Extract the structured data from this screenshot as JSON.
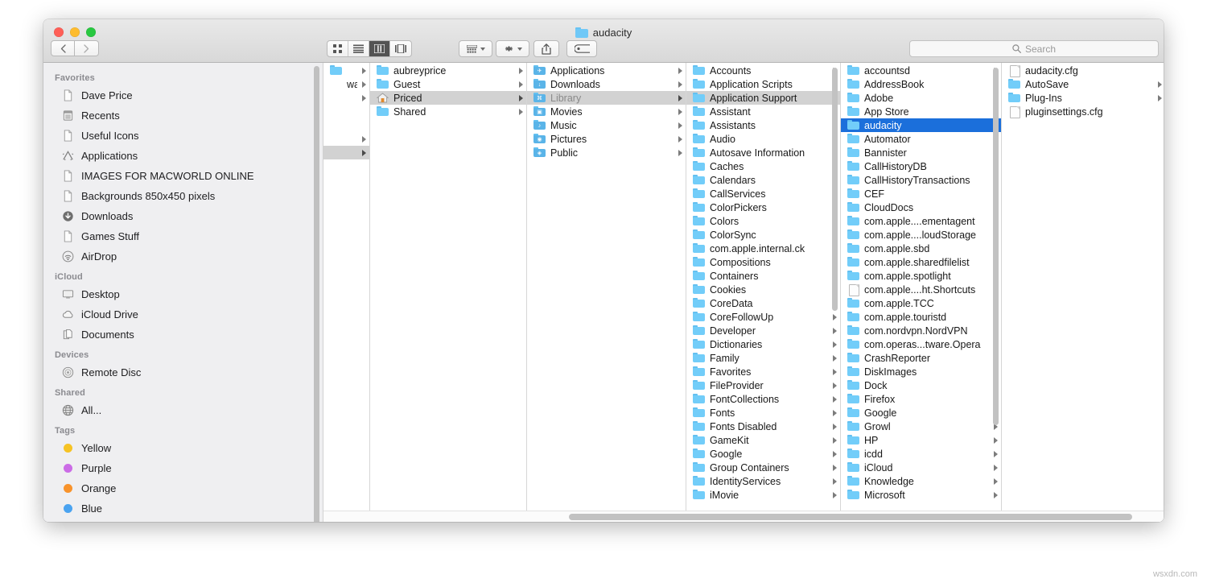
{
  "window": {
    "title": "audacity",
    "title_icon": "folder-icon",
    "traffic_lights": [
      {
        "name": "close",
        "color": "#ff5f57"
      },
      {
        "name": "minimize",
        "color": "#febc2e"
      },
      {
        "name": "zoom",
        "color": "#28c840"
      }
    ]
  },
  "toolbar": {
    "back_label": "‹",
    "forward_label": "›",
    "view_modes": [
      {
        "name": "icon-view",
        "icon": "grid-icon",
        "active": false
      },
      {
        "name": "list-view",
        "icon": "list-icon",
        "active": false
      },
      {
        "name": "column-view",
        "icon": "columns-icon",
        "active": true
      },
      {
        "name": "gallery-view",
        "icon": "gallery-icon",
        "active": false
      }
    ],
    "group_button": {
      "name": "group-by",
      "icon": "group-icon"
    },
    "action_button": {
      "name": "action-menu",
      "icon": "gear-icon"
    },
    "share_button": {
      "name": "share",
      "icon": "share-icon"
    },
    "tags_button": {
      "name": "tags",
      "icon": "tag-icon"
    }
  },
  "search": {
    "placeholder": "Search",
    "icon": "search-icon",
    "value": ""
  },
  "sidebar": {
    "sections": [
      {
        "title": "Favorites",
        "items": [
          {
            "label": "Dave Price",
            "icon": "document-icon"
          },
          {
            "label": "Recents",
            "icon": "recents-icon"
          },
          {
            "label": "Useful Icons",
            "icon": "document-icon"
          },
          {
            "label": "Applications",
            "icon": "applications-icon"
          },
          {
            "label": "IMAGES FOR MACWORLD ONLINE",
            "icon": "document-icon"
          },
          {
            "label": "Backgrounds 850x450 pixels",
            "icon": "document-icon"
          },
          {
            "label": "Downloads",
            "icon": "downloads-icon"
          },
          {
            "label": "Games Stuff",
            "icon": "document-icon"
          },
          {
            "label": "AirDrop",
            "icon": "airdrop-icon"
          }
        ]
      },
      {
        "title": "iCloud",
        "items": [
          {
            "label": "Desktop",
            "icon": "desktop-icon"
          },
          {
            "label": "iCloud Drive",
            "icon": "cloud-icon"
          },
          {
            "label": "Documents",
            "icon": "documents-icon"
          }
        ]
      },
      {
        "title": "Devices",
        "items": [
          {
            "label": "Remote Disc",
            "icon": "disc-icon"
          }
        ]
      },
      {
        "title": "Shared",
        "items": [
          {
            "label": "All...",
            "icon": "globe-icon"
          }
        ]
      },
      {
        "title": "Tags",
        "items": [
          {
            "label": "Yellow",
            "icon": "tag-dot-icon",
            "color": "#f8c察"
          },
          {
            "label": "Purple",
            "icon": "tag-dot-icon",
            "color": "#cb6ce6"
          },
          {
            "label": "Orange",
            "icon": "tag-dot-icon",
            "color": "#f8932b"
          },
          {
            "label": "Blue",
            "icon": "tag-dot-icon",
            "color": "#4aa3f0"
          }
        ]
      }
    ],
    "tag_colors": {
      "Yellow": "#f6c324",
      "Purple": "#cb6ce6",
      "Orange": "#f8932b",
      "Blue": "#4aa3f0"
    }
  },
  "columns": [
    {
      "name": "column-partial",
      "truncated": true,
      "items": [
        {
          "label": "",
          "icon": "folder-icon",
          "has_arrow": true,
          "selected": false
        },
        {
          "label": "ware",
          "icon": "none",
          "has_arrow": true,
          "selected": false
        },
        {
          "label": "",
          "icon": "none",
          "has_arrow": true,
          "selected": false
        },
        {
          "label": "",
          "icon": "none",
          "has_arrow": false,
          "selected": false
        },
        {
          "label": "",
          "icon": "none",
          "has_arrow": false,
          "selected": false
        },
        {
          "label": "",
          "icon": "none",
          "has_arrow": true,
          "selected": false
        },
        {
          "label": "",
          "icon": "none",
          "has_arrow": true,
          "selected": true
        }
      ]
    },
    {
      "name": "column-users",
      "items": [
        {
          "label": "aubreyprice",
          "icon": "folder-icon",
          "has_arrow": true,
          "selected": false
        },
        {
          "label": "Guest",
          "icon": "folder-icon",
          "has_arrow": true,
          "selected": false
        },
        {
          "label": "Priced",
          "icon": "home-icon",
          "has_arrow": true,
          "selected": true
        },
        {
          "label": "Shared",
          "icon": "folder-icon",
          "has_arrow": true,
          "selected": false
        }
      ]
    },
    {
      "name": "column-home",
      "items": [
        {
          "label": "Applications",
          "icon": "folder-applications-icon",
          "has_arrow": true,
          "selected": false
        },
        {
          "label": "Downloads",
          "icon": "folder-downloads-icon",
          "has_arrow": true,
          "selected": false
        },
        {
          "label": "Library",
          "icon": "folder-library-icon",
          "has_arrow": true,
          "selected": true,
          "dimmed": true
        },
        {
          "label": "Movies",
          "icon": "folder-movies-icon",
          "has_arrow": true,
          "selected": false
        },
        {
          "label": "Music",
          "icon": "folder-music-icon",
          "has_arrow": true,
          "selected": false
        },
        {
          "label": "Pictures",
          "icon": "folder-pictures-icon",
          "has_arrow": true,
          "selected": false
        },
        {
          "label": "Public",
          "icon": "folder-public-icon",
          "has_arrow": true,
          "selected": false
        }
      ]
    },
    {
      "name": "column-library",
      "scrollbar": {
        "top_pct": 0,
        "height_pct": 53
      },
      "items": [
        {
          "label": "Accounts",
          "icon": "folder-icon",
          "has_arrow": true,
          "selected": false
        },
        {
          "label": "Application Scripts",
          "icon": "folder-icon",
          "has_arrow": true,
          "selected": false
        },
        {
          "label": "Application Support",
          "icon": "folder-icon",
          "has_arrow": true,
          "selected": true
        },
        {
          "label": "Assistant",
          "icon": "folder-icon",
          "has_arrow": true,
          "selected": false
        },
        {
          "label": "Assistants",
          "icon": "folder-icon",
          "has_arrow": true,
          "selected": false
        },
        {
          "label": "Audio",
          "icon": "folder-icon",
          "has_arrow": true,
          "selected": false
        },
        {
          "label": "Autosave Information",
          "icon": "folder-icon",
          "has_arrow": true,
          "selected": false
        },
        {
          "label": "Caches",
          "icon": "folder-icon",
          "has_arrow": true,
          "selected": false
        },
        {
          "label": "Calendars",
          "icon": "folder-icon",
          "has_arrow": true,
          "selected": false
        },
        {
          "label": "CallServices",
          "icon": "folder-icon",
          "has_arrow": true,
          "selected": false
        },
        {
          "label": "ColorPickers",
          "icon": "folder-icon",
          "has_arrow": true,
          "selected": false
        },
        {
          "label": "Colors",
          "icon": "folder-icon",
          "has_arrow": true,
          "selected": false
        },
        {
          "label": "ColorSync",
          "icon": "folder-icon",
          "has_arrow": true,
          "selected": false
        },
        {
          "label": "com.apple.internal.ck",
          "icon": "folder-icon",
          "has_arrow": true,
          "selected": false
        },
        {
          "label": "Compositions",
          "icon": "folder-icon",
          "has_arrow": true,
          "selected": false
        },
        {
          "label": "Containers",
          "icon": "folder-icon",
          "has_arrow": true,
          "selected": false
        },
        {
          "label": "Cookies",
          "icon": "folder-icon",
          "has_arrow": true,
          "selected": false
        },
        {
          "label": "CoreData",
          "icon": "folder-icon",
          "has_arrow": true,
          "selected": false
        },
        {
          "label": "CoreFollowUp",
          "icon": "folder-icon",
          "has_arrow": true,
          "selected": false
        },
        {
          "label": "Developer",
          "icon": "folder-icon",
          "has_arrow": true,
          "selected": false
        },
        {
          "label": "Dictionaries",
          "icon": "folder-icon",
          "has_arrow": true,
          "selected": false
        },
        {
          "label": "Family",
          "icon": "folder-icon",
          "has_arrow": true,
          "selected": false
        },
        {
          "label": "Favorites",
          "icon": "folder-icon",
          "has_arrow": true,
          "selected": false
        },
        {
          "label": "FileProvider",
          "icon": "folder-icon",
          "has_arrow": true,
          "selected": false
        },
        {
          "label": "FontCollections",
          "icon": "folder-icon",
          "has_arrow": true,
          "selected": false
        },
        {
          "label": "Fonts",
          "icon": "folder-icon",
          "has_arrow": true,
          "selected": false
        },
        {
          "label": "Fonts Disabled",
          "icon": "folder-icon",
          "has_arrow": true,
          "selected": false
        },
        {
          "label": "GameKit",
          "icon": "folder-icon",
          "has_arrow": true,
          "selected": false
        },
        {
          "label": "Google",
          "icon": "folder-icon",
          "has_arrow": true,
          "selected": false
        },
        {
          "label": "Group Containers",
          "icon": "folder-icon",
          "has_arrow": true,
          "selected": false
        },
        {
          "label": "IdentityServices",
          "icon": "folder-icon",
          "has_arrow": true,
          "selected": false
        },
        {
          "label": "iMovie",
          "icon": "folder-icon",
          "has_arrow": true,
          "selected": false
        }
      ]
    },
    {
      "name": "column-application-support",
      "scrollbar": {
        "top_pct": 0,
        "height_pct": 78
      },
      "items": [
        {
          "label": "accountsd",
          "icon": "folder-icon",
          "has_arrow": true,
          "selected": false
        },
        {
          "label": "AddressBook",
          "icon": "folder-icon",
          "has_arrow": true,
          "selected": false
        },
        {
          "label": "Adobe",
          "icon": "folder-icon",
          "has_arrow": true,
          "selected": false
        },
        {
          "label": "App Store",
          "icon": "folder-icon",
          "has_arrow": true,
          "selected": false
        },
        {
          "label": "audacity",
          "icon": "folder-icon",
          "has_arrow": true,
          "selected": true
        },
        {
          "label": "Automator",
          "icon": "folder-icon",
          "has_arrow": true,
          "selected": false
        },
        {
          "label": "Bannister",
          "icon": "folder-icon",
          "has_arrow": true,
          "selected": false
        },
        {
          "label": "CallHistoryDB",
          "icon": "folder-icon",
          "has_arrow": true,
          "selected": false
        },
        {
          "label": "CallHistoryTransactions",
          "icon": "folder-icon",
          "has_arrow": true,
          "selected": false
        },
        {
          "label": "CEF",
          "icon": "folder-icon",
          "has_arrow": true,
          "selected": false
        },
        {
          "label": "CloudDocs",
          "icon": "folder-icon",
          "has_arrow": true,
          "selected": false
        },
        {
          "label": "com.apple....ementagent",
          "icon": "folder-icon",
          "has_arrow": true,
          "selected": false
        },
        {
          "label": "com.apple....loudStorage",
          "icon": "folder-icon",
          "has_arrow": true,
          "selected": false
        },
        {
          "label": "com.apple.sbd",
          "icon": "folder-icon",
          "has_arrow": true,
          "selected": false
        },
        {
          "label": "com.apple.sharedfilelist",
          "icon": "folder-icon",
          "has_arrow": true,
          "selected": false
        },
        {
          "label": "com.apple.spotlight",
          "icon": "folder-icon",
          "has_arrow": true,
          "selected": false
        },
        {
          "label": "com.apple....ht.Shortcuts",
          "icon": "file-icon",
          "has_arrow": false,
          "selected": false
        },
        {
          "label": "com.apple.TCC",
          "icon": "folder-icon",
          "has_arrow": true,
          "selected": false
        },
        {
          "label": "com.apple.touristd",
          "icon": "folder-icon",
          "has_arrow": true,
          "selected": false
        },
        {
          "label": "com.nordvpn.NordVPN",
          "icon": "folder-icon",
          "has_arrow": true,
          "selected": false
        },
        {
          "label": "com.operas...tware.Opera",
          "icon": "folder-icon",
          "has_arrow": true,
          "selected": false
        },
        {
          "label": "CrashReporter",
          "icon": "folder-icon",
          "has_arrow": true,
          "selected": false
        },
        {
          "label": "DiskImages",
          "icon": "folder-icon",
          "has_arrow": true,
          "selected": false
        },
        {
          "label": "Dock",
          "icon": "folder-icon",
          "has_arrow": true,
          "selected": false
        },
        {
          "label": "Firefox",
          "icon": "folder-icon",
          "has_arrow": true,
          "selected": false
        },
        {
          "label": "Google",
          "icon": "folder-icon",
          "has_arrow": true,
          "selected": false
        },
        {
          "label": "Growl",
          "icon": "folder-icon",
          "has_arrow": true,
          "selected": false
        },
        {
          "label": "HP",
          "icon": "folder-icon",
          "has_arrow": true,
          "selected": false
        },
        {
          "label": "icdd",
          "icon": "folder-icon",
          "has_arrow": true,
          "selected": false
        },
        {
          "label": "iCloud",
          "icon": "folder-icon",
          "has_arrow": true,
          "selected": false
        },
        {
          "label": "Knowledge",
          "icon": "folder-icon",
          "has_arrow": true,
          "selected": false
        },
        {
          "label": "Microsoft",
          "icon": "folder-icon",
          "has_arrow": true,
          "selected": false
        }
      ]
    },
    {
      "name": "column-audacity",
      "items": [
        {
          "label": "audacity.cfg",
          "icon": "file-icon",
          "has_arrow": false,
          "selected": false
        },
        {
          "label": "AutoSave",
          "icon": "folder-icon",
          "has_arrow": true,
          "selected": false
        },
        {
          "label": "Plug-Ins",
          "icon": "folder-icon",
          "has_arrow": true,
          "selected": false
        },
        {
          "label": "pluginsettings.cfg",
          "icon": "file-icon",
          "has_arrow": false,
          "selected": false
        }
      ]
    }
  ],
  "watermark": "wsxdn.com",
  "colors": {
    "selection_blue": "#1b6fdb",
    "selection_gray": "#d2d2d2",
    "folder_blue": "#72cdf9",
    "sidebar_bg": "#efeff1"
  }
}
